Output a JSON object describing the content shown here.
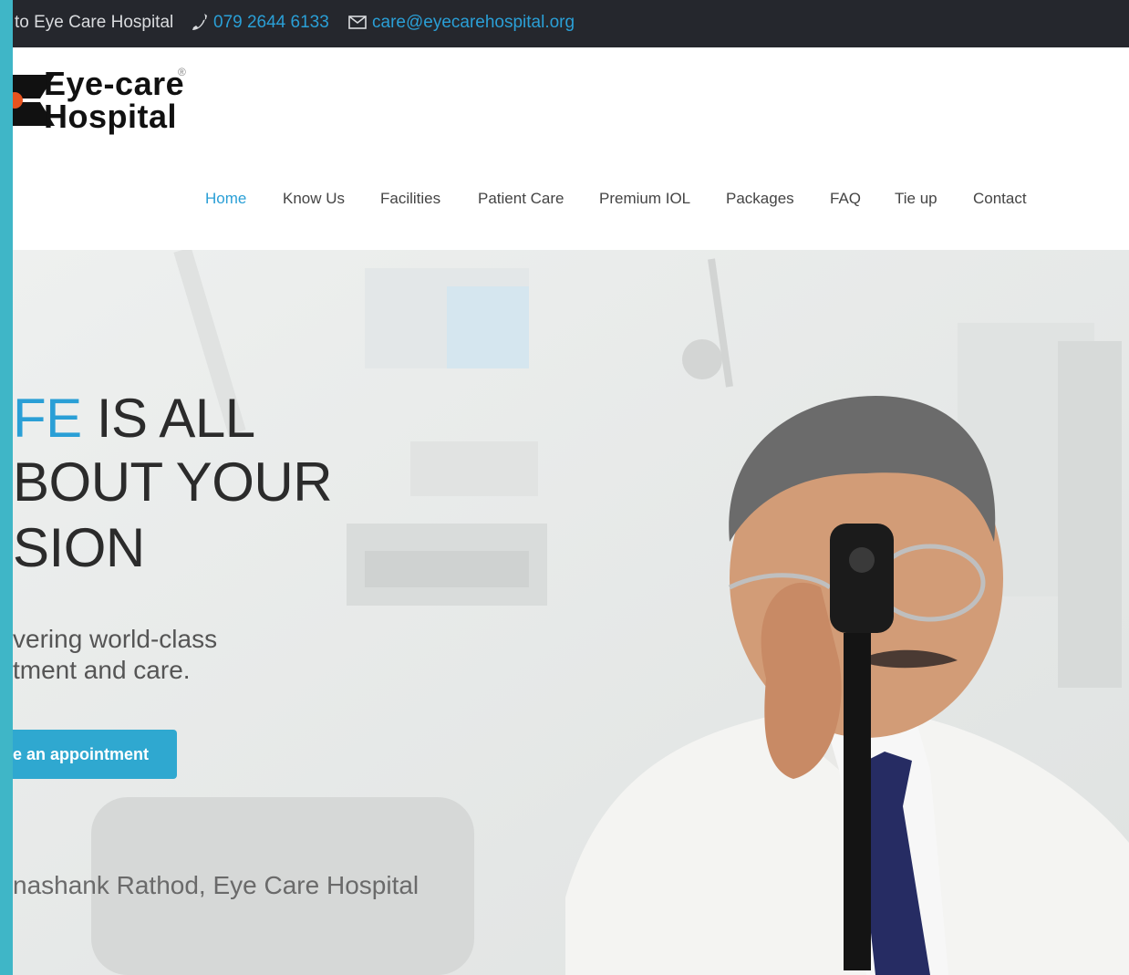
{
  "topbar": {
    "welcome_text": "to Eye Care Hospital",
    "phone": "079 2644 6133",
    "email": "care@eyecarehospital.org",
    "phone_icon": "phone-icon",
    "mail_icon": "mail-icon"
  },
  "logo": {
    "line1": "Eye-care",
    "line2": "Hospital",
    "registered": "®"
  },
  "nav": {
    "items": [
      {
        "label": "Home",
        "active": true
      },
      {
        "label": "Know Us"
      },
      {
        "label": "Facilities"
      },
      {
        "label": "Patient Care"
      },
      {
        "label": "Premium IOL"
      },
      {
        "label": "Packages"
      },
      {
        "label": "FAQ"
      },
      {
        "label": "Tie up"
      },
      {
        "label": "Contact"
      }
    ]
  },
  "hero": {
    "headline_line1_accent": "FE",
    "headline_line1_rest": " IS ALL",
    "headline_line2": "BOUT YOUR",
    "headline_line3": "SION",
    "sub_line1": "vering world-class",
    "sub_line2": "tment and care.",
    "cta_label": "e an appointment",
    "caption": "nashank Rathod, Eye Care Hospital"
  },
  "colors": {
    "accent": "#2a9fd6",
    "topbar_bg": "#25272d",
    "button_bg": "#2fa8d0",
    "stripe": "#3fb6c7"
  }
}
